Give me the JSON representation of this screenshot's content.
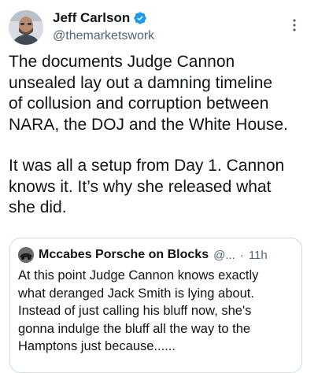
{
  "author": {
    "display_name": "Jeff Carlson",
    "handle": "@themarketswork",
    "avatar_icon": "person-avatar-icon",
    "verified_icon": "verified-badge-icon",
    "verified_color": "#1d9bf0"
  },
  "more_icon": "more-options-icon",
  "tweet": {
    "paragraph_1": "The documents Judge Cannon\nunsealed lay out a damning timeline\nof collusion and corruption between\nNARA, the DOJ and the White House.",
    "paragraph_2": "It was all a setup from Day 1. Cannon\nknows it. It’s why she released what\nshe did."
  },
  "quoted_tweet": {
    "display_name": "Mccabes Porsche on Blocks",
    "handle_truncated": "@...",
    "separator": "·",
    "time": "11h",
    "text": "At this point Judge Cannon knows exactly\nwhat deranged Jack Smith is lying about.\nInstead of just calling his bluff now, she's\ngonna indulge the bluff all the way to the\nHamptons just because......"
  },
  "colors": {
    "text_primary": "#0f1419",
    "text_secondary": "#536471",
    "border": "#cfd9de"
  }
}
